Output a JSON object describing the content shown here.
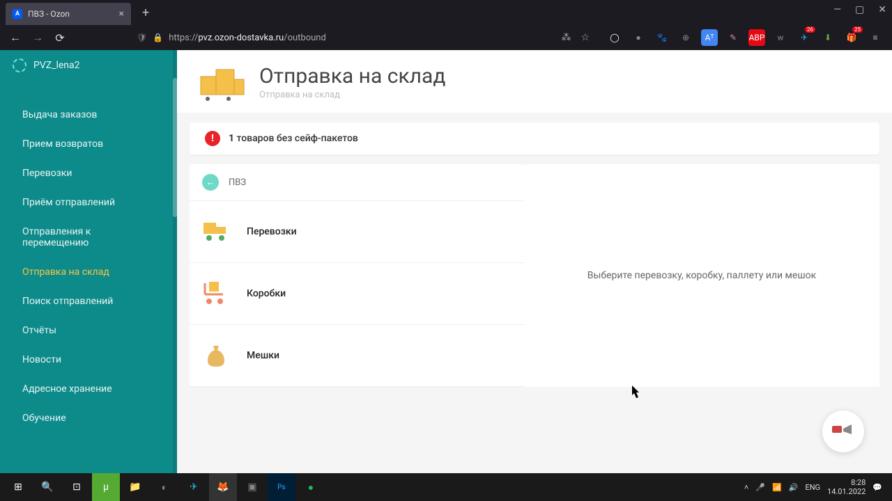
{
  "browser": {
    "tab_title": "ПВЗ - Ozon",
    "url_proto": "https://",
    "url_domain": "pvz.ozon-dostavka.ru",
    "url_path": "/outbound"
  },
  "sidebar": {
    "account": "PVZ_lena2",
    "items": [
      {
        "label": "Выдача заказов"
      },
      {
        "label": "Прием возвратов"
      },
      {
        "label": "Перевозки"
      },
      {
        "label": "Приём отправлений"
      },
      {
        "label": "Отправления к перемещению"
      },
      {
        "label": "Отправка на склад",
        "active": true
      },
      {
        "label": "Поиск отправлений"
      },
      {
        "label": "Отчёты"
      },
      {
        "label": "Новости"
      },
      {
        "label": "Адресное хранение"
      },
      {
        "label": "Обучение"
      }
    ]
  },
  "page": {
    "title": "Отправка на склад",
    "subtitle": "Отправка на склад",
    "alert_count": "1",
    "alert_text": "товаров без сейф-пакетов",
    "pvz_label": "ПВЗ",
    "list": [
      {
        "label": "Перевозки"
      },
      {
        "label": "Коробки"
      },
      {
        "label": "Мешки"
      }
    ],
    "placeholder": "Выберите перевозку, коробку, паллету или мешок"
  },
  "taskbar": {
    "lang": "ENG",
    "time": "8:28",
    "date": "14.01.2022"
  },
  "ext_badges": {
    "tg": "26",
    "dl": "25"
  }
}
